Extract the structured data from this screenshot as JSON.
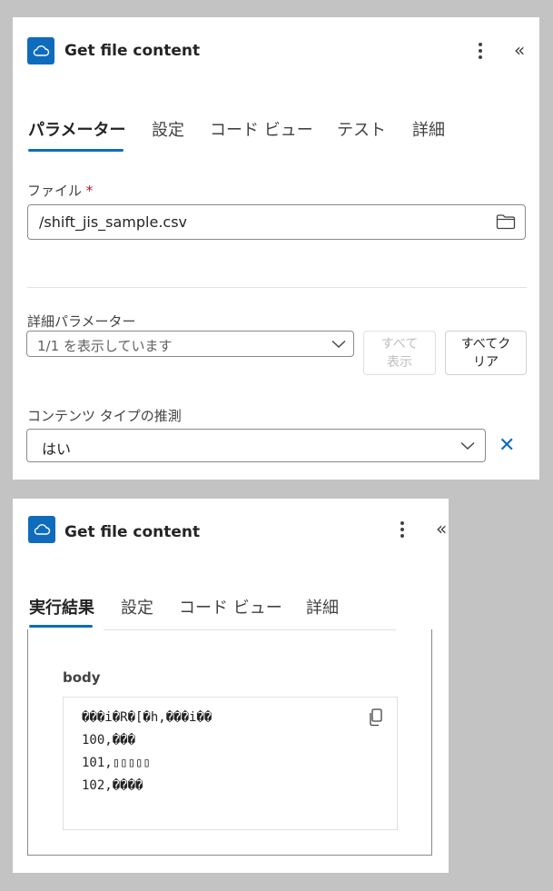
{
  "panel1": {
    "header": {
      "title": "Get file content",
      "logo_icon": "onedrive-cloud-icon",
      "more_icon": "more-vertical-icon",
      "collapse_icon": "double-chevron-left-icon",
      "collapse_glyph": "«"
    },
    "tabs": [
      {
        "label": "パラメーター",
        "active": true
      },
      {
        "label": "設定",
        "active": false
      },
      {
        "label": "コード ビュー",
        "active": false
      },
      {
        "label": "テスト",
        "active": false
      },
      {
        "label": "詳細",
        "active": false
      }
    ],
    "file": {
      "label": "ファイル",
      "required_mark": "*",
      "value": "/shift_jis_sample.csv",
      "picker_icon": "folder-icon"
    },
    "advanced": {
      "label": "詳細パラメーター",
      "dropdown_value": "1/1 を表示しています",
      "show_all_button": [
        "すべて",
        "表示"
      ],
      "clear_all_button": [
        "すべてク",
        "リア"
      ]
    },
    "content_type": {
      "label": "コンテンツ タイプの推測",
      "value": "はい",
      "remove_icon": "close-icon",
      "remove_glyph": "✕"
    }
  },
  "panel2": {
    "header": {
      "title": "Get file content",
      "logo_icon": "onedrive-cloud-icon",
      "more_icon": "more-vertical-icon",
      "collapse_icon": "double-chevron-left-icon",
      "collapse_glyph": "«"
    },
    "tabs": [
      {
        "label": "実行結果",
        "active": true
      },
      {
        "label": "設定",
        "active": false
      },
      {
        "label": "コード ビュー",
        "active": false
      },
      {
        "label": "詳細",
        "active": false
      }
    ],
    "output": {
      "section_label": "body",
      "copy_icon": "copy-icon",
      "lines": [
        "���i�R�[�h,���i��",
        "100,���",
        "101,▯▯▯▯▯",
        "102,����"
      ]
    }
  },
  "colors": {
    "accent": "#0f6cbd",
    "background": "#c3c3c3",
    "panel": "#ffffff",
    "border": "#8a8a8a",
    "divider": "#e0e0e0"
  }
}
